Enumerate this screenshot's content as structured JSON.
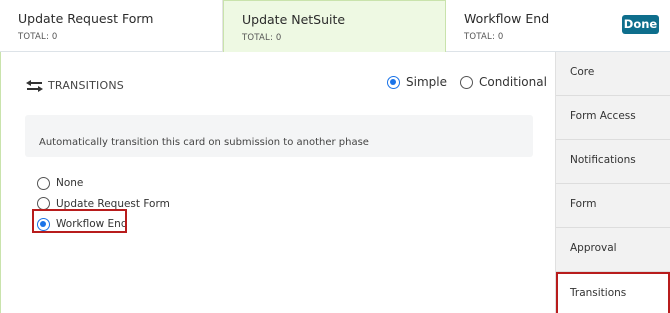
{
  "phases": [
    {
      "name": "Update Request Form",
      "total": "TOTAL: 0"
    },
    {
      "name": "Update NetSuite",
      "total": "TOTAL: 0"
    },
    {
      "name": "Workflow End",
      "total": "TOTAL: 0"
    }
  ],
  "done_label": "Done",
  "section": {
    "title": "TRANSITIONS",
    "icon": "swap-arrows-icon"
  },
  "mode": {
    "options": [
      "Simple",
      "Conditional"
    ],
    "selected": "Simple"
  },
  "description": "Automatically transition this card on submission to another phase",
  "transition_options": {
    "items": [
      "None",
      "Update Request Form",
      "Workflow End"
    ],
    "selected": "Workflow End"
  },
  "sidebar": {
    "items": [
      "Core",
      "Form Access",
      "Notifications",
      "Form",
      "Approval",
      "Transitions"
    ],
    "active": "Transitions"
  },
  "colors": {
    "accent": "#1a73e8",
    "done_button": "#0e6e8c",
    "active_phase_bg": "#eef9e3",
    "highlight": "#b81c1c"
  }
}
